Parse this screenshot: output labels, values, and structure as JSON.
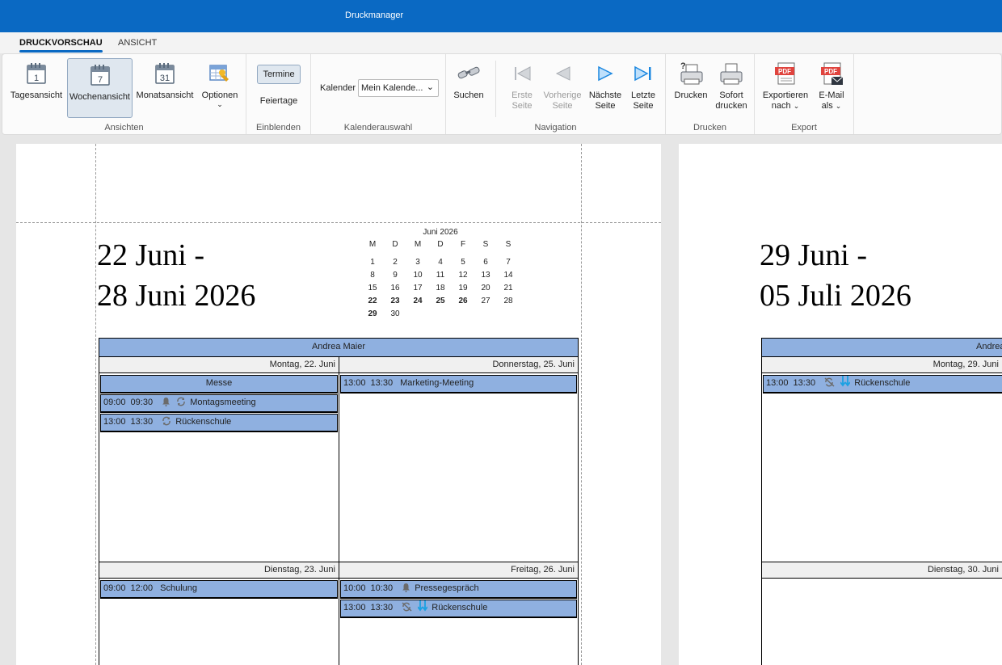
{
  "window": {
    "title": "Druckmanager"
  },
  "tabs": [
    {
      "label": "DRUCKVORSCHAU",
      "active": true
    },
    {
      "label": "ANSICHT",
      "active": false
    }
  ],
  "ribbon": {
    "ansichten": {
      "label": "Ansichten",
      "tagesansicht": "Tagesansicht",
      "wochenansicht": "Wochenansicht",
      "monatsansicht": "Monatsansicht",
      "optionen": "Optionen",
      "icon_day_number": "1",
      "icon_week_number": "7",
      "icon_month_number": "31"
    },
    "einblenden": {
      "label": "Einblenden",
      "termine": "Termine",
      "feiertage": "Feiertage"
    },
    "kalenderauswahl": {
      "label": "Kalenderauswahl",
      "kalender_label": "Kalender",
      "kalender_value": "Mein Kalende..."
    },
    "suchen": "Suchen",
    "navigation": {
      "label": "Navigation",
      "erste_1": "Erste",
      "erste_2": "Seite",
      "vorherige_1": "Vorherige",
      "vorherige_2": "Seite",
      "naechste_1": "Nächste",
      "naechste_2": "Seite",
      "letzte_1": "Letzte",
      "letzte_2": "Seite"
    },
    "drucken": {
      "label": "Drucken",
      "drucken": "Drucken",
      "sofort_1": "Sofort",
      "sofort_2": "drucken"
    },
    "export": {
      "label": "Export",
      "exportieren_1": "Exportieren",
      "exportieren_2": "nach",
      "email_1": "E-Mail",
      "email_2": "als",
      "pdf_text": "PDF"
    }
  },
  "page1": {
    "range_line1": "22 Juni -",
    "range_line2": "28 Juni 2026",
    "mini_cal": {
      "title": "Juni 2026",
      "weekdays": [
        "M",
        "D",
        "M",
        "D",
        "F",
        "S",
        "S"
      ],
      "weeks": [
        [
          "1",
          "2",
          "3",
          "4",
          "5",
          "6",
          "7"
        ],
        [
          "8",
          "9",
          "10",
          "11",
          "12",
          "13",
          "14"
        ],
        [
          "15",
          "16",
          "17",
          "18",
          "19",
          "20",
          "21"
        ],
        [
          "22",
          "23",
          "24",
          "25",
          "26",
          "27",
          "28"
        ],
        [
          "29",
          "30",
          "",
          "",
          "",
          "",
          ""
        ]
      ],
      "bold": [
        "22",
        "23",
        "24",
        "25",
        "26",
        "29"
      ]
    },
    "resource": "Andrea Maier",
    "days": {
      "mon": "Montag, 22. Juni",
      "tue": "Dienstag, 23. Juni",
      "thu": "Donnerstag, 25. Juni",
      "fri": "Freitag, 26. Juni"
    },
    "events": {
      "messe": "Messe",
      "e1": {
        "start": "09:00",
        "end": "09:30",
        "title": "Montagsmeeting"
      },
      "e2": {
        "start": "13:00",
        "end": "13:30",
        "title": "Rückenschule"
      },
      "e3": {
        "start": "09:00",
        "end": "12:00",
        "title": "Schulung"
      },
      "e4": {
        "start": "13:00",
        "end": "13:30",
        "title": "Marketing-Meeting"
      },
      "e5": {
        "start": "10:00",
        "end": "10:30",
        "title": "Pressegespräch"
      },
      "e6": {
        "start": "13:00",
        "end": "13:30",
        "title": "Rückenschule"
      }
    }
  },
  "page2": {
    "range_line1": "29 Juni -",
    "range_line2": "05 Juli 2026",
    "resource": "Andrea",
    "days": {
      "mon": "Montag, 29. Juni",
      "tue": "Dienstag, 30. Juni"
    },
    "events": {
      "e1": {
        "start": "13:00",
        "end": "13:30",
        "title": "Rückenschule"
      }
    }
  }
}
